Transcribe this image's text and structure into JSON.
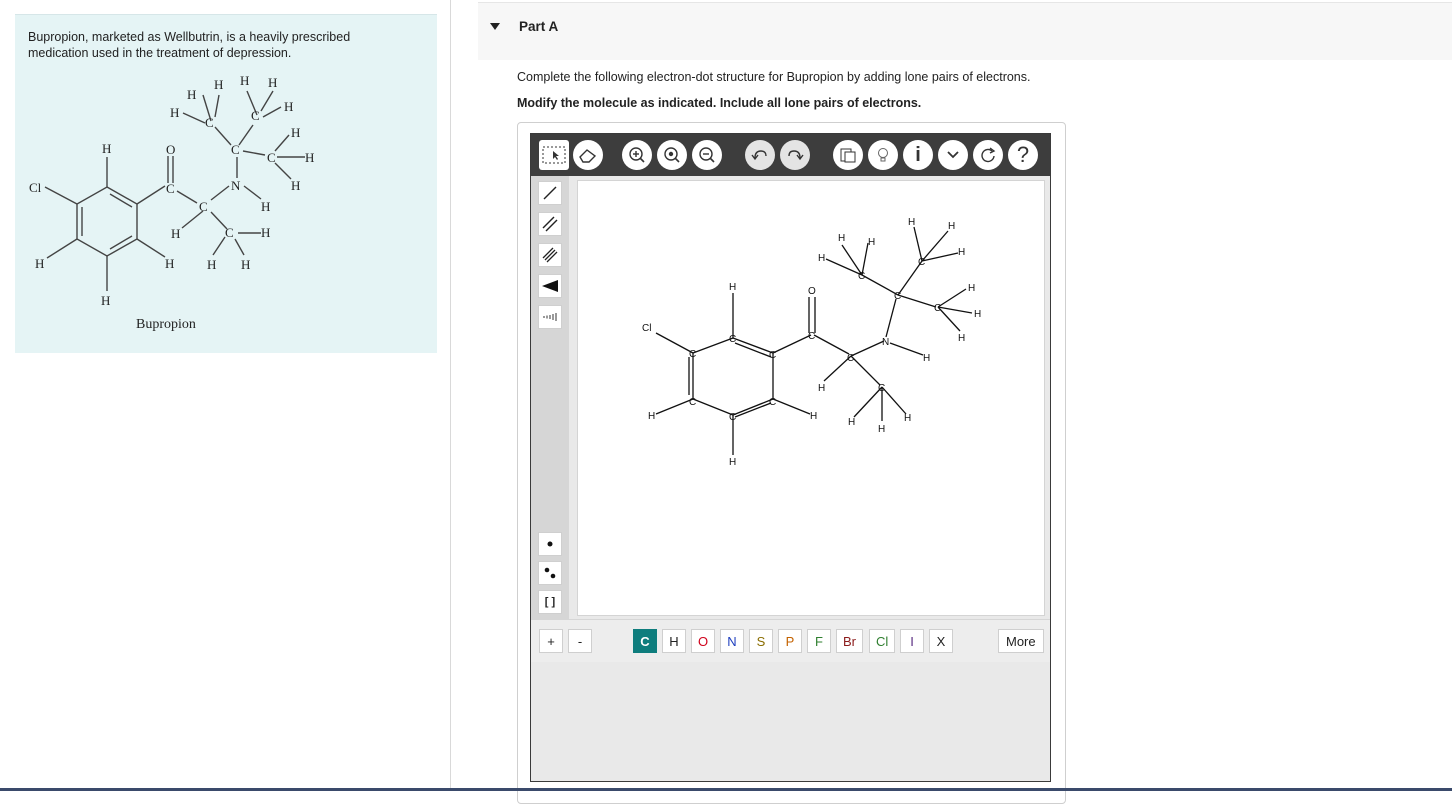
{
  "intro": {
    "description": "Bupropion, marketed as Wellbutrin, is a heavily prescribed medication used in the treatment of depression.",
    "caption": "Bupropion"
  },
  "part": {
    "title": "Part A",
    "instruction": "Complete the following electron-dot structure for Bupropion by adding lone pairs of electrons.",
    "modify_instruction": "Modify the molecule as indicated. Include all lone pairs of electrons."
  },
  "editor": {
    "toolbar_icons": [
      "select-icon",
      "eraser-icon",
      "zoom-in-icon",
      "zoom-fit-icon",
      "zoom-out-icon",
      "undo-icon",
      "redo-icon",
      "template-icon",
      "hint-icon",
      "info-icon",
      "expand-icon",
      "reset-icon",
      "help-icon"
    ],
    "info_label": "i",
    "help_label": "?",
    "bracket_label": "[ ]",
    "charge_plus": "+",
    "charge_minus": "-",
    "elements": [
      "C",
      "H",
      "O",
      "N",
      "S",
      "P",
      "F",
      "Br",
      "Cl",
      "I",
      "X"
    ],
    "more_label": "More",
    "selected_element": "C"
  },
  "colors": {
    "panel_bg": "#e5f4f5",
    "toolbar_bg": "#3d3d3d",
    "active_element": "#0e7d7d",
    "element_O": "#d0021b",
    "element_N": "#1f3fbf",
    "element_Br": "#8b1a1a",
    "element_Cl": "#2f7f2f"
  },
  "molecule_atoms": {
    "Cl": "Cl",
    "C": "C",
    "H": "H",
    "O": "O",
    "N": "N"
  }
}
